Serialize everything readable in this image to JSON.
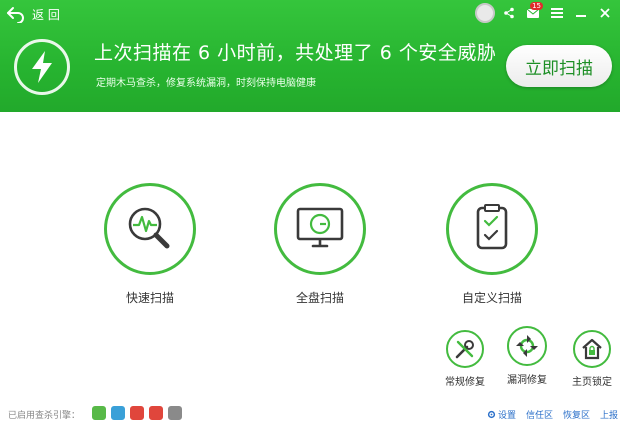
{
  "topbar": {
    "back_label": "返 回",
    "mail_badge": "15"
  },
  "header": {
    "title": "上次扫描在 6 小时前，共处理了 6 个安全威胁",
    "subtitle": "定期木马查杀，修复系统漏洞，时刻保持电脑健康",
    "scan_button": "立即扫描"
  },
  "modes": [
    {
      "label": "快速扫描",
      "icon": "pulse-magnifier-icon"
    },
    {
      "label": "全盘扫描",
      "icon": "monitor-scan-icon"
    },
    {
      "label": "自定义扫描",
      "icon": "checklist-icon"
    }
  ],
  "tools": [
    {
      "label": "常规修复",
      "icon": "wrench-screwdriver-icon"
    },
    {
      "label": "漏洞修复",
      "icon": "sync-arrows-icon"
    },
    {
      "label": "主页锁定",
      "icon": "home-lock-icon"
    }
  ],
  "footer": {
    "engines_label": "已启用查杀引擎：",
    "engine_colors": [
      "#58b948",
      "#3aa0d8",
      "#e0463c",
      "#e0463c",
      "#8a8a8a"
    ],
    "links": {
      "settings": "设置",
      "trust": "信任区",
      "restore": "恢复区",
      "upload": "上报"
    }
  },
  "colors": {
    "brand_green": "#27b430",
    "ring_green": "#43bb3f"
  }
}
